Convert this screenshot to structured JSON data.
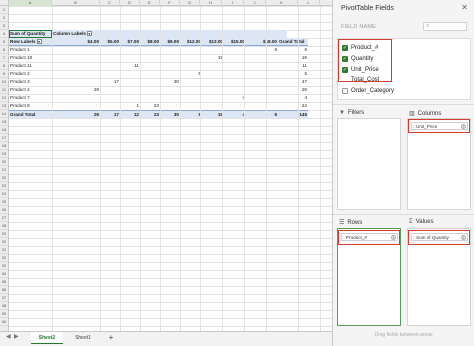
{
  "sheet": {
    "columns": [
      "A",
      "B",
      "C",
      "D",
      "E",
      "F",
      "G",
      "H",
      "I",
      "J",
      "K",
      "L",
      "M"
    ],
    "rows": [
      "1",
      "2",
      "3",
      "4",
      "5",
      "6",
      "7",
      "8",
      "9",
      "10",
      "11",
      "12",
      "13",
      "14",
      "15",
      "16",
      "17",
      "18",
      "19",
      "20",
      "21",
      "22",
      "23",
      "24",
      "25",
      "26",
      "27",
      "28",
      "29",
      "30",
      "31",
      "32",
      "33",
      "34",
      "35",
      "36",
      "37",
      "38",
      "39",
      "40"
    ],
    "selected_column": "A"
  },
  "pivot": {
    "corner_label": "Sum of Quantity",
    "column_labels": "Column Labels",
    "row_labels": "Row Labels",
    "price_headers": [
      "$4.00",
      "$5.00",
      "$7.00",
      "$8.00",
      "$9.00",
      "$12.00",
      "$13.00",
      "$15.00",
      "$18.00"
    ],
    "grand_total_header": "Grand Total",
    "rows": [
      {
        "label": "Product 1",
        "values": [
          "",
          "",
          "",
          "",
          "",
          "",
          "",
          "",
          "6"
        ],
        "total": "6"
      },
      {
        "label": "Product 10",
        "values": [
          "",
          "",
          "",
          "",
          "",
          "",
          "19",
          "",
          ""
        ],
        "total": "19"
      },
      {
        "label": "Product 11",
        "values": [
          "",
          "",
          "11",
          "",
          "",
          "",
          "",
          "",
          ""
        ],
        "total": "11"
      },
      {
        "label": "Product 2",
        "values": [
          "",
          "",
          "",
          "",
          "",
          "5",
          "",
          "",
          ""
        ],
        "total": "5"
      },
      {
        "label": "Product 3",
        "values": [
          "",
          "17",
          "",
          "",
          "30",
          "",
          "",
          "",
          ""
        ],
        "total": "47"
      },
      {
        "label": "Product 4",
        "values": [
          "29",
          "",
          "",
          "",
          "",
          "",
          "",
          "",
          ""
        ],
        "total": "29"
      },
      {
        "label": "Product 7",
        "values": [
          "",
          "",
          "",
          "",
          "",
          "",
          "",
          "4",
          ""
        ],
        "total": "4"
      },
      {
        "label": "Product 8",
        "values": [
          "",
          "",
          "1",
          "23",
          "",
          "",
          "",
          "",
          ""
        ],
        "total": "24"
      }
    ],
    "grand_total_label": "Grand Total",
    "grand_totals": [
      "29",
      "17",
      "12",
      "23",
      "30",
      "5",
      "19",
      "4",
      "6"
    ],
    "grand_total_all": "145"
  },
  "tabs": {
    "items": [
      "Sheet2",
      "Sheet1"
    ],
    "active": "Sheet2",
    "add": "+"
  },
  "pane": {
    "title": "PivotTable Fields",
    "close": "✕",
    "field_name_label": "FIELD NAME",
    "search_icon": "magnifier-icon",
    "fields": [
      {
        "label": "Product_#",
        "checked": true
      },
      {
        "label": "Quantity",
        "checked": true
      },
      {
        "label": "Unit_Price",
        "checked": true
      },
      {
        "label": "Total_Cost",
        "checked": false
      },
      {
        "label": "Order_Category",
        "checked": false
      }
    ],
    "filters_label": "Filters",
    "columns_label": "Columns",
    "rows_label": "Rows",
    "values_label": "Values",
    "columns_pill": "Unit_Price",
    "rows_pill": "Product_#",
    "values_pill": "Sum of Quantity",
    "footer_hint": "Drag fields between areas",
    "highlight_color": "#d63b2b",
    "accent_color": "#2e7d32"
  }
}
